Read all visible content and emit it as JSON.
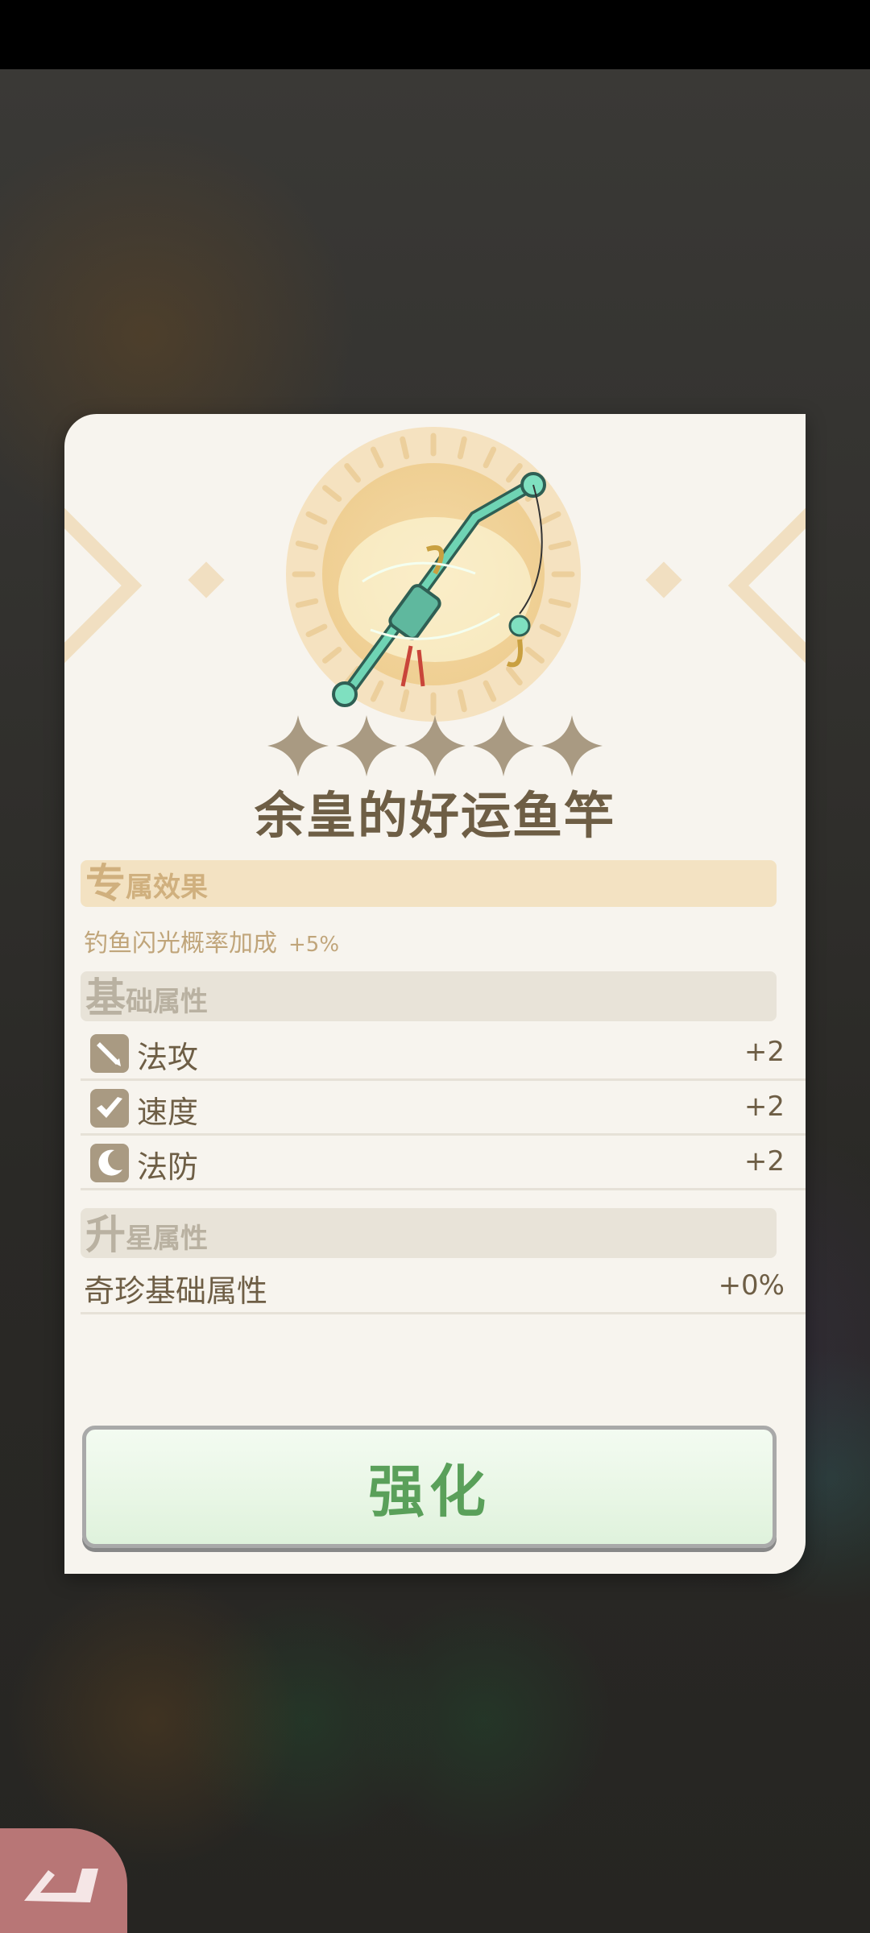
{
  "item": {
    "name": "余皇的好运鱼竿",
    "stars": 5
  },
  "sections": {
    "exclusive": {
      "big": "专",
      "rest": "属效果"
    },
    "base": {
      "big": "基",
      "rest": "础属性"
    },
    "star": {
      "big": "升",
      "rest": "星属性"
    }
  },
  "exclusive_effect": {
    "text": "钓鱼闪光概率加成",
    "value": "+5%"
  },
  "base_attributes": [
    {
      "icon": "magic-attack-icon",
      "label": "法攻",
      "value": "+2"
    },
    {
      "icon": "speed-icon",
      "label": "速度",
      "value": "+2"
    },
    {
      "icon": "magic-defense-icon",
      "label": "法防",
      "value": "+2"
    }
  ],
  "star_attributes": [
    {
      "label": "奇珍基础属性",
      "value": "+0%"
    }
  ],
  "actions": {
    "enhance_label": "强化"
  },
  "colors": {
    "accent_green": "#5aa05a",
    "text_brown": "#6e5e45",
    "card_bg": "#f7f4ee"
  }
}
